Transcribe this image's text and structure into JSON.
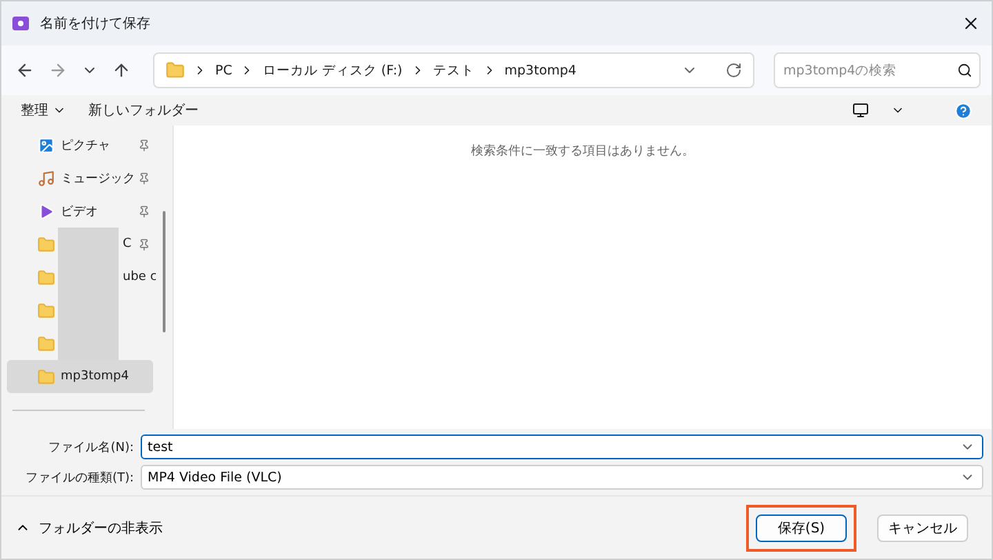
{
  "window": {
    "title": "名前を付けて保存"
  },
  "nav": {
    "breadcrumb": [
      "PC",
      "ローカル ディスク (F:)",
      "テスト",
      "mp3tomp4"
    ],
    "search": {
      "placeholder": "mp3tomp4の検索"
    }
  },
  "toolbar": {
    "organize": "整理",
    "new_folder": "新しいフォルダー"
  },
  "sidebar": {
    "items": [
      {
        "kind": "pictures",
        "label": "ピクチャ",
        "pinned": true,
        "redacted": false,
        "selected": false
      },
      {
        "kind": "music",
        "label": "ミュージック",
        "pinned": true,
        "redacted": false,
        "selected": false
      },
      {
        "kind": "videos",
        "label": "ビデオ",
        "pinned": true,
        "redacted": false,
        "selected": false
      },
      {
        "kind": "folder",
        "label": "C",
        "pinned": true,
        "redacted": true,
        "selected": false
      },
      {
        "kind": "folder",
        "label": "ube c",
        "pinned": false,
        "redacted": true,
        "selected": false
      },
      {
        "kind": "folder",
        "pinned": false,
        "redacted": true,
        "selected": false
      },
      {
        "kind": "folder",
        "pinned": false,
        "redacted": true,
        "selected": false
      },
      {
        "kind": "folder",
        "label": "mp3tomp4",
        "pinned": false,
        "redacted": false,
        "selected": true
      }
    ]
  },
  "content": {
    "empty_message": "検索条件に一致する項目はありません。"
  },
  "fields": [
    {
      "label": "ファイル名(N):",
      "value": "test",
      "focused": true
    },
    {
      "label": "ファイルの種類(T):",
      "value": "MP4 Video File (VLC)",
      "focused": false
    }
  ],
  "footer": {
    "hide_folders": "フォルダーの非表示",
    "buttons": [
      {
        "label": "保存(S)",
        "primary": true,
        "highlighted": true
      },
      {
        "label": "キャンセル",
        "primary": false,
        "highlighted": false
      }
    ]
  }
}
